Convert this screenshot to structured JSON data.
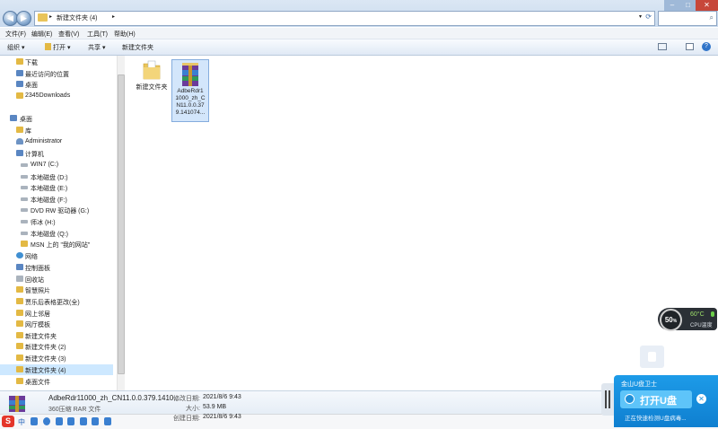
{
  "window": {
    "breadcrumb": "新建文件夹 (4)"
  },
  "menubar": [
    {
      "label": "文件(F)"
    },
    {
      "label": "编辑(E)"
    },
    {
      "label": "查看(V)"
    },
    {
      "label": "工具(T)"
    },
    {
      "label": "帮助(H)"
    }
  ],
  "toolbar": {
    "organize": "组织 ▾",
    "open": "打开 ▾",
    "share": "共享 ▾",
    "new_folder": "新建文件夹"
  },
  "nav": [
    {
      "label": "下载",
      "icon": "download-folder-icon"
    },
    {
      "label": "最近访问的位置",
      "icon": "recent-places-icon"
    },
    {
      "label": "桌面",
      "icon": "desktop-icon"
    },
    {
      "label": "2345Downloads",
      "icon": "folder-icon"
    },
    {
      "label": "桌面",
      "icon": "desktop-icon"
    },
    {
      "label": "库",
      "icon": "library-icon"
    },
    {
      "label": "Administrator",
      "icon": "user-folder-icon"
    },
    {
      "label": "计算机",
      "icon": "computer-icon"
    },
    {
      "label": "WIN7 (C:)",
      "icon": "drive-icon"
    },
    {
      "label": "本地磁盘 (D:)",
      "icon": "drive-icon"
    },
    {
      "label": "本地磁盘 (E:)",
      "icon": "drive-icon"
    },
    {
      "label": "本地磁盘 (F:)",
      "icon": "drive-icon"
    },
    {
      "label": "DVD RW 驱动器 (G:)",
      "icon": "dvd-drive-icon"
    },
    {
      "label": "师冰 (H:)",
      "icon": "drive-icon"
    },
    {
      "label": "本地磁盘 (Q:)",
      "icon": "drive-icon"
    },
    {
      "label": "MSN 上的 \"我的网站\"",
      "icon": "folder-icon"
    },
    {
      "label": "网络",
      "icon": "network-icon"
    },
    {
      "label": "控制面板",
      "icon": "control-panel-icon"
    },
    {
      "label": "回收站",
      "icon": "recycle-bin-icon"
    },
    {
      "label": "智慧照片",
      "icon": "folder-icon"
    },
    {
      "label": "贾乐后表格更改(全)",
      "icon": "folder-icon"
    },
    {
      "label": "网上邻居",
      "icon": "folder-icon"
    },
    {
      "label": "网厅模板",
      "icon": "folder-icon"
    },
    {
      "label": "新建文件夹",
      "icon": "folder-icon"
    },
    {
      "label": "新建文件夹 (2)",
      "icon": "folder-icon"
    },
    {
      "label": "新建文件夹 (3)",
      "icon": "folder-icon"
    },
    {
      "label": "新建文件夹 (4)",
      "icon": "folder-icon"
    },
    {
      "label": "桌面文件",
      "icon": "folder-icon"
    }
  ],
  "files": [
    {
      "label": "新建文件夹",
      "icon": "folder-icon"
    },
    {
      "label_lines": [
        "AdbeRdr1",
        "1000_zh_C",
        "N11.0.0.37",
        "9.141074..."
      ],
      "icon": "winrar-archive-icon"
    }
  ],
  "details": {
    "filename": "AdbeRdr11000_zh_CN11.0.0.379.1410...",
    "filetype": "360压缩 RAR 文件",
    "modified_label": "修改日期:",
    "modified_value": "2021/8/6 9:43",
    "size_label": "大小:",
    "size_value": "53.9 MB",
    "created_label": "创建日期:",
    "created_value": "2021/8/6 9:43"
  },
  "cpu_widget": {
    "percent": "50",
    "percent_unit": "%",
    "temperature": "60°C",
    "label": "CPU温度"
  },
  "usb_widget": {
    "title": "金山U盘卫士",
    "button": "打开U盘",
    "status": "正在快速检测U盘病毒..."
  },
  "taskbar": {
    "ime": "中"
  },
  "colors": {
    "selection": "#cde8ff",
    "accent": "#1d9be8",
    "titlebar": "#c9daee"
  }
}
